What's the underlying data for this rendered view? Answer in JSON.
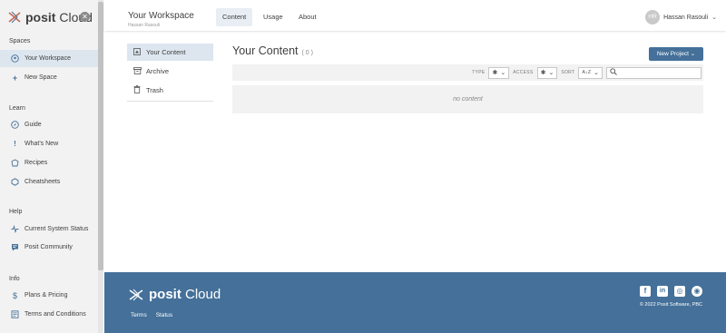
{
  "brand": {
    "name_bold": "posit",
    "name_rest": " Cloud",
    "collapse_glyph": "✕"
  },
  "sidebar": {
    "spaces_title": "Spaces",
    "spaces": [
      {
        "label": "Your Workspace",
        "icon": "workspace-icon",
        "active": true
      },
      {
        "label": "New Space",
        "icon": "plus-icon"
      }
    ],
    "learn_title": "Learn",
    "learn": [
      {
        "label": "Guide",
        "icon": "compass-icon"
      },
      {
        "label": "What's New",
        "icon": "exclamation-icon"
      },
      {
        "label": "Recipes",
        "icon": "recipe-icon"
      },
      {
        "label": "Cheatsheets",
        "icon": "cheatsheet-icon"
      }
    ],
    "help_title": "Help",
    "help": [
      {
        "label": "Current System Status",
        "icon": "pulse-icon"
      },
      {
        "label": "Posit Community",
        "icon": "chat-icon"
      }
    ],
    "info_title": "Info",
    "info": [
      {
        "label": "Plans & Pricing",
        "icon": "dollar-icon"
      },
      {
        "label": "Terms and Conditions",
        "icon": "document-icon"
      }
    ]
  },
  "header": {
    "workspace_title": "Your Workspace",
    "workspace_owner": "Hassan Rasouli",
    "tabs": [
      {
        "label": "Content",
        "active": true
      },
      {
        "label": "Usage"
      },
      {
        "label": "About"
      }
    ],
    "user_initials": "HR",
    "user_name": "Hassan Rasouli"
  },
  "subnav": [
    {
      "label": "Your Content",
      "icon": "content-icon",
      "active": true
    },
    {
      "label": "Archive",
      "icon": "archive-icon"
    },
    {
      "label": "Trash",
      "icon": "trash-icon"
    }
  ],
  "main": {
    "title": "Your Content",
    "count": "( 0 )",
    "new_project_label": "New Project",
    "filters": {
      "type_label": "TYPE",
      "type_value": "✱",
      "access_label": "ACCESS",
      "access_value": "✱",
      "sort_label": "SORT",
      "sort_value": "A↓Z",
      "search_placeholder": ""
    },
    "empty_message": "no content"
  },
  "footer": {
    "logo_bold": "posit",
    "logo_rest": " Cloud",
    "links": [
      "Terms",
      "Status"
    ],
    "social": [
      {
        "name": "facebook-icon",
        "glyph": "f"
      },
      {
        "name": "linkedin-icon",
        "glyph": "in"
      },
      {
        "name": "instagram-icon",
        "glyph": "◎"
      },
      {
        "name": "github-icon",
        "glyph": "◉"
      }
    ],
    "copyright": "© 2022 Posit Software, PBC"
  },
  "colors": {
    "brand_blue": "#447099",
    "sidebar_bg": "#f2f2f2",
    "active_bg": "#dde6ef"
  }
}
